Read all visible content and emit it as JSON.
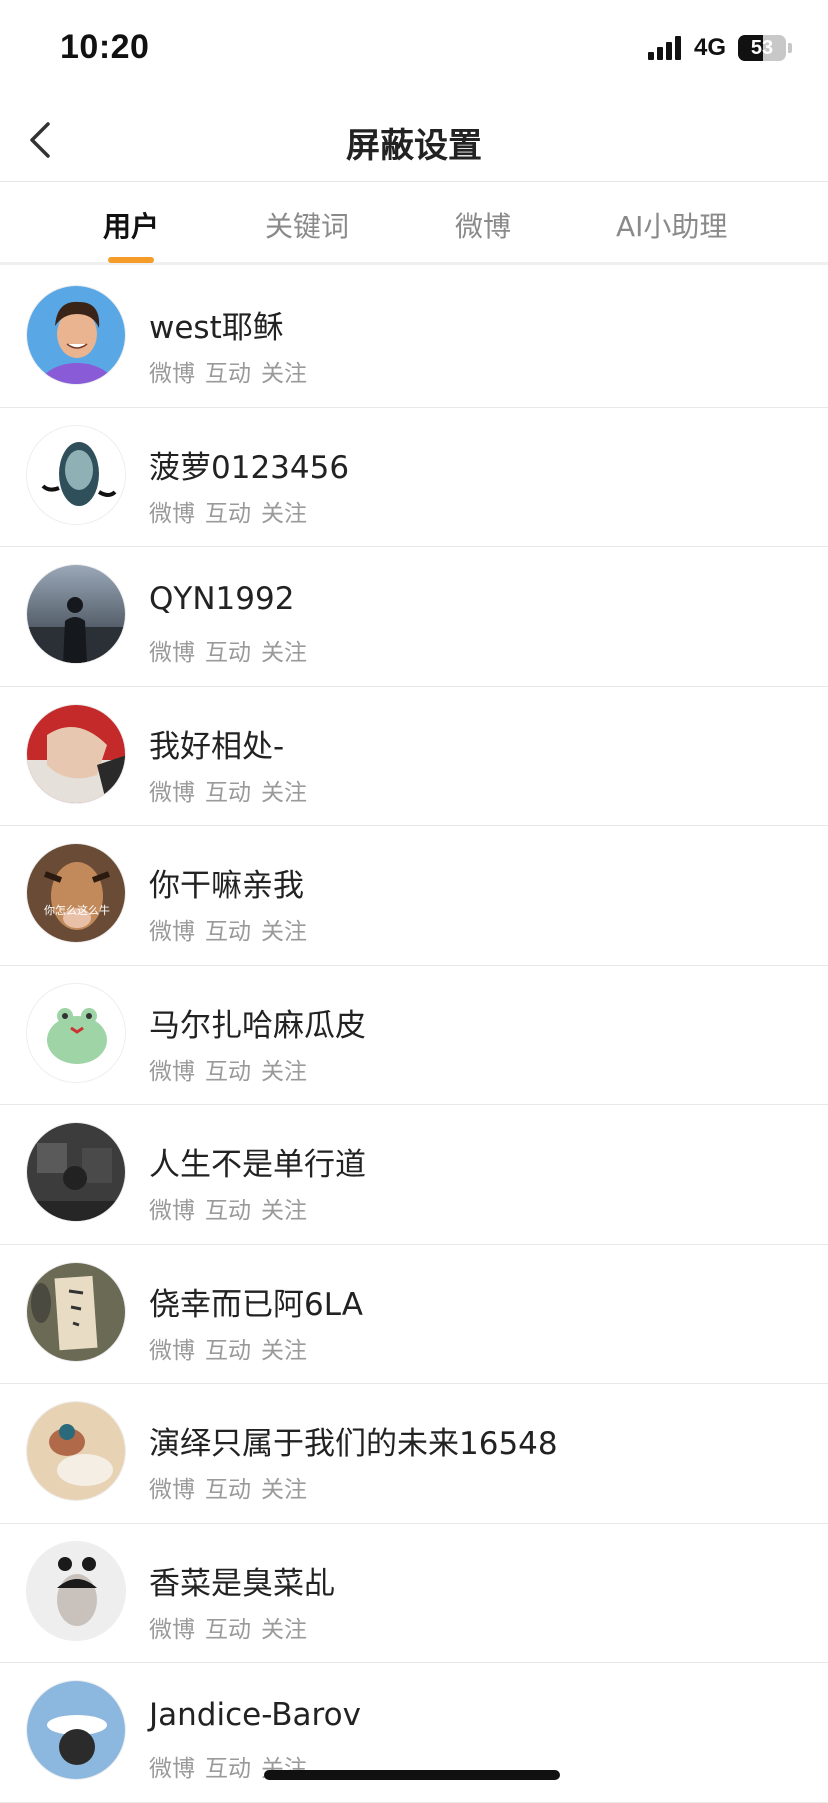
{
  "status": {
    "time": "10:20",
    "network": "4G",
    "battery": "53",
    "battery_level": 0.53
  },
  "header": {
    "title": "屏蔽设置"
  },
  "tabs": [
    {
      "label": "用户"
    },
    {
      "label": "关键词"
    },
    {
      "label": "微博"
    },
    {
      "label": "AI小助理"
    }
  ],
  "active_tab": "用户",
  "users": [
    {
      "name": "west耶稣",
      "tags": [
        "微博",
        "互动",
        "关注"
      ]
    },
    {
      "name": "菠萝0123456",
      "tags": [
        "微博",
        "互动",
        "关注"
      ]
    },
    {
      "name": "QYN1992",
      "tags": [
        "微博",
        "互动",
        "关注"
      ]
    },
    {
      "name": "我好相处-",
      "tags": [
        "微博",
        "互动",
        "关注"
      ]
    },
    {
      "name": "你干嘛亲我",
      "tags": [
        "微博",
        "互动",
        "关注"
      ]
    },
    {
      "name": "马尔扎哈麻瓜皮",
      "tags": [
        "微博",
        "互动",
        "关注"
      ]
    },
    {
      "name": "人生不是单行道",
      "tags": [
        "微博",
        "互动",
        "关注"
      ]
    },
    {
      "name": "侥幸而已阿6LA",
      "tags": [
        "微博",
        "互动",
        "关注"
      ]
    },
    {
      "name": "演绎只属于我们的未来16548",
      "tags": [
        "微博",
        "互动",
        "关注"
      ]
    },
    {
      "name": "香菜是臭菜乩",
      "tags": [
        "微博",
        "互动",
        "关注"
      ]
    },
    {
      "name": "Jandice-Barov",
      "tags": [
        "微博",
        "互动",
        "关注"
      ]
    }
  ],
  "avatar_caption_5": "你怎么这么牛",
  "colors": {
    "accent": "#f59b2a",
    "text": "#222222",
    "muted": "#9a9a9a"
  }
}
